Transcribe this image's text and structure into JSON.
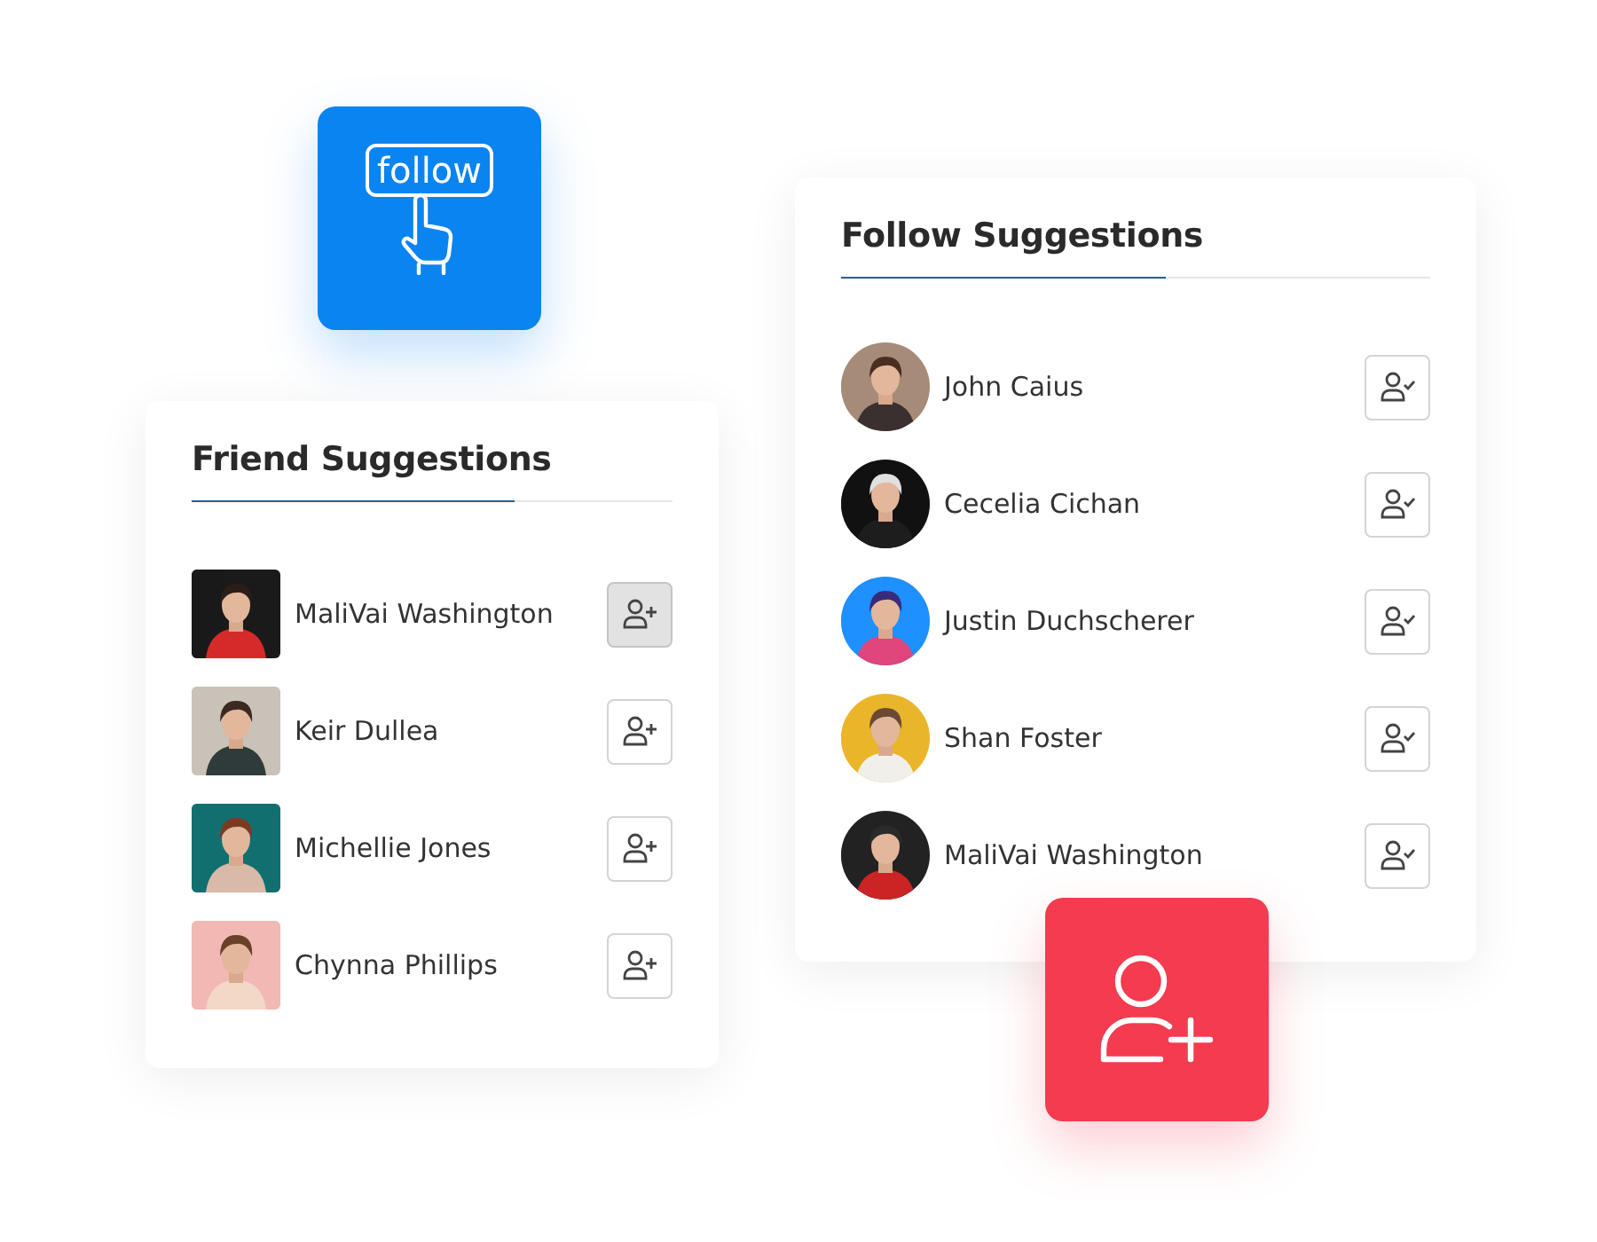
{
  "follow_badge": {
    "label": "follow"
  },
  "friend_suggestions": {
    "title": "Friend Suggestions",
    "people": [
      {
        "name": "MaliVai Washington",
        "hovered": true
      },
      {
        "name": "Keir Dullea",
        "hovered": false
      },
      {
        "name": "Michellie Jones",
        "hovered": false
      },
      {
        "name": "Chynna Phillips",
        "hovered": false
      }
    ]
  },
  "follow_suggestions": {
    "title": "Follow Suggestions",
    "people": [
      {
        "name": "John Caius"
      },
      {
        "name": "Cecelia Cichan"
      },
      {
        "name": "Justin Duchscherer"
      },
      {
        "name": "Shan Foster"
      },
      {
        "name": "MaliVai Washington"
      }
    ]
  }
}
